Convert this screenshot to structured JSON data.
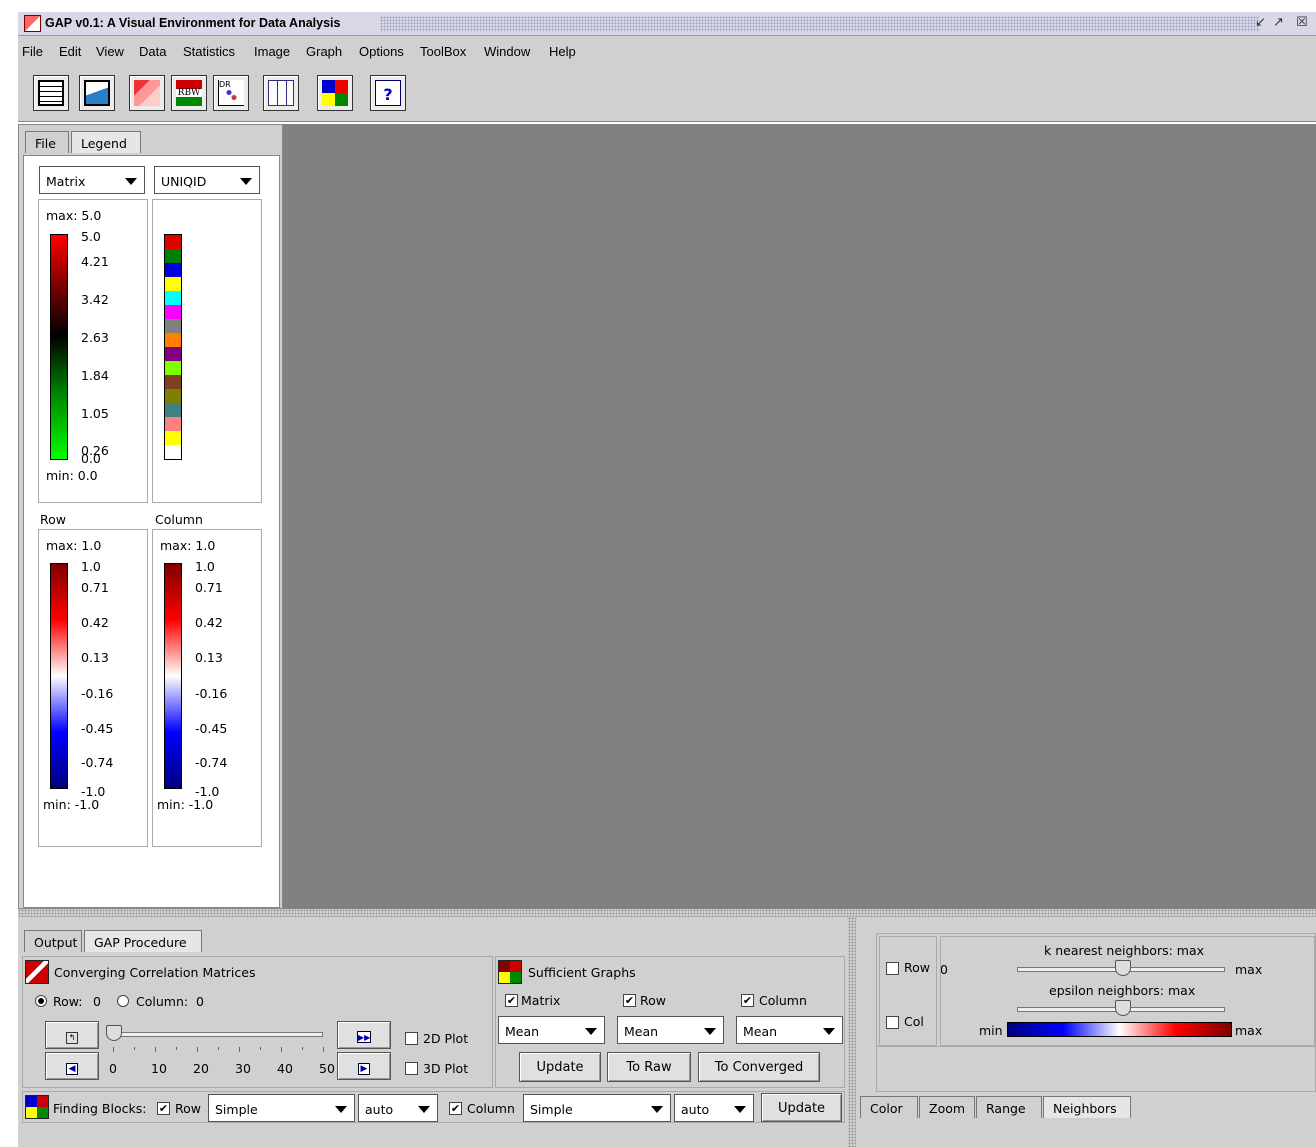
{
  "window": {
    "title": "GAP v0.1: A Visual Environment for Data Analysis"
  },
  "menu": [
    "File",
    "Edit",
    "View",
    "Data",
    "Statistics",
    "Image",
    "Graph",
    "Options",
    "ToolBox",
    "Window",
    "Help"
  ],
  "toolbar_icons": [
    "open-data-icon",
    "import-data-icon",
    "matrix-map-icon",
    "rbw-icon",
    "dr-plot-icon",
    "graph-view-icon",
    "color-grid-icon",
    "help-icon"
  ],
  "left_tabs": [
    "File",
    "Legend"
  ],
  "legend": {
    "matrix_select": "Matrix",
    "column_select": "UNIQID",
    "matrix_max": "max: 5.0",
    "matrix_min": "min: 0.0",
    "matrix_ticks": [
      "5.0",
      "4.21",
      "3.42",
      "2.63",
      "1.84",
      "1.05",
      "0.26",
      "0.0"
    ],
    "id_colors": [
      "#e00000",
      "#008000",
      "#0000e0",
      "#ffff00",
      "#00ffff",
      "#ff00ff",
      "#808080",
      "#ff8000",
      "#800080",
      "#80ff00",
      "#804020",
      "#808000",
      "#408080",
      "#ff8080",
      "#ffff00"
    ],
    "row_title": "Row",
    "column_title": "Column",
    "row_max": "max: 1.0",
    "row_min": "min: -1.0",
    "col_max": "max: 1.0",
    "col_min": "min: -1.0",
    "corr_ticks": [
      "1.0",
      "0.71",
      "0.42",
      "0.13",
      "-0.16",
      "-0.45",
      "-0.74",
      "-1.0"
    ]
  },
  "bottom_tabs": [
    "Output",
    "GAP Procedure"
  ],
  "procedure": {
    "converging_title": "Converging Correlation Matrices",
    "row_radio": "Row:",
    "row_value": "0",
    "column_radio": "Column:",
    "column_value": "0",
    "slider_value": 0,
    "slider_ticks": [
      "0",
      "10",
      "20",
      "30",
      "40",
      "50"
    ],
    "plot2d": "2D Plot",
    "plot3d": "3D Plot",
    "sufficient_title": "Sufficient Graphs",
    "chk_matrix": "Matrix",
    "chk_row": "Row",
    "chk_column": "Column",
    "mean1": "Mean",
    "mean2": "Mean",
    "mean3": "Mean",
    "update": "Update",
    "to_raw": "To Raw",
    "to_converged": "To Converged"
  },
  "finding": {
    "label": "Finding Blocks:",
    "row": "Row",
    "row_method": "Simple",
    "row_auto": "auto",
    "column": "Column",
    "col_method": "Simple",
    "col_auto": "auto",
    "update": "Update"
  },
  "neighbors": {
    "row": "Row",
    "col": "Col",
    "zero": "0",
    "knn_title": "k nearest neighbors: max",
    "knn_max": "max",
    "eps_title": "epsilon neighbors: max",
    "min": "min",
    "max": "max"
  },
  "right_tabs": [
    "Color",
    "Zoom",
    "Range",
    "Neighbors"
  ]
}
